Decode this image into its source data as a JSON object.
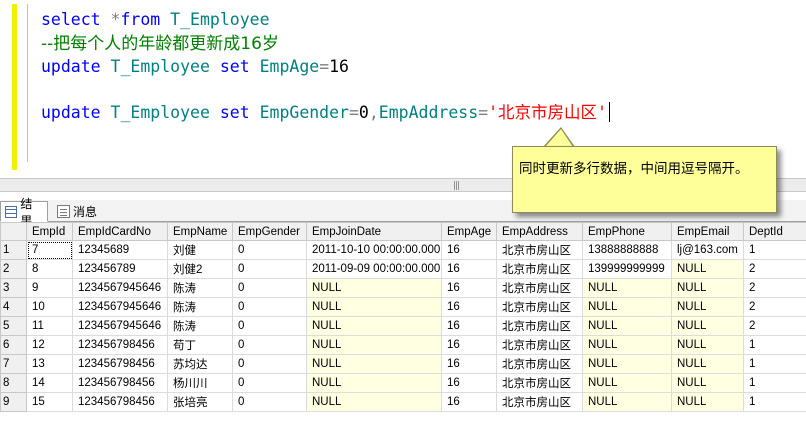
{
  "editor": {
    "line1": {
      "kw1": "select",
      "rest": " *",
      "kw2": "from",
      "obj": "T_Employee"
    },
    "comment": "--把每个人的年龄都更新成16岁",
    "line3": {
      "kw1": "update",
      "obj": "T_Employee",
      "kw2": "set",
      "col": "EmpAge",
      "op": "=",
      "val": "16"
    },
    "line4": {
      "kw1": "update",
      "obj": "T_Employee",
      "kw2": "set",
      "col1": "EmpGender",
      "op1": "=",
      "val1": "0",
      "comma": ",",
      "col2": "EmpAddress",
      "op2": "=",
      "str": "'北京市房山区'"
    }
  },
  "tabs": {
    "results": "结果",
    "messages": "消息"
  },
  "callout": "同时更新多行数据，中间用逗号隔开。",
  "grid": {
    "columns": [
      "",
      "EmpId",
      "EmpIdCardNo",
      "EmpName",
      "EmpGender",
      "EmpJoinDate",
      "EmpAge",
      "EmpAddress",
      "EmpPhone",
      "EmpEmail",
      "DeptId"
    ],
    "rows": [
      [
        "1",
        "7",
        "12345689",
        "刘健",
        "0",
        "2011-10-10 00:00:00.000",
        "16",
        "北京市房山区",
        "13888888888",
        "lj@163.com",
        "1"
      ],
      [
        "2",
        "8",
        "123456789",
        "刘健2",
        "0",
        "2011-09-09 00:00:00.000",
        "16",
        "北京市房山区",
        "139999999999",
        "NULL",
        "2"
      ],
      [
        "3",
        "9",
        "1234567945646",
        "陈涛",
        "0",
        "NULL",
        "16",
        "北京市房山区",
        "NULL",
        "NULL",
        "2"
      ],
      [
        "4",
        "10",
        "1234567945646",
        "陈涛",
        "0",
        "NULL",
        "16",
        "北京市房山区",
        "NULL",
        "NULL",
        "2"
      ],
      [
        "5",
        "11",
        "1234567945646",
        "陈涛",
        "0",
        "NULL",
        "16",
        "北京市房山区",
        "NULL",
        "NULL",
        "2"
      ],
      [
        "6",
        "12",
        "123456798456",
        "苟丁",
        "0",
        "NULL",
        "16",
        "北京市房山区",
        "NULL",
        "NULL",
        "1"
      ],
      [
        "7",
        "13",
        "123456798456",
        "苏均达",
        "0",
        "NULL",
        "16",
        "北京市房山区",
        "NULL",
        "NULL",
        "1"
      ],
      [
        "8",
        "14",
        "123456798456",
        "杨川川",
        "0",
        "NULL",
        "16",
        "北京市房山区",
        "NULL",
        "NULL",
        "1"
      ],
      [
        "9",
        "15",
        "123456798456",
        "张培亮",
        "0",
        "NULL",
        "16",
        "北京市房山区",
        "NULL",
        "NULL",
        "1"
      ]
    ]
  }
}
